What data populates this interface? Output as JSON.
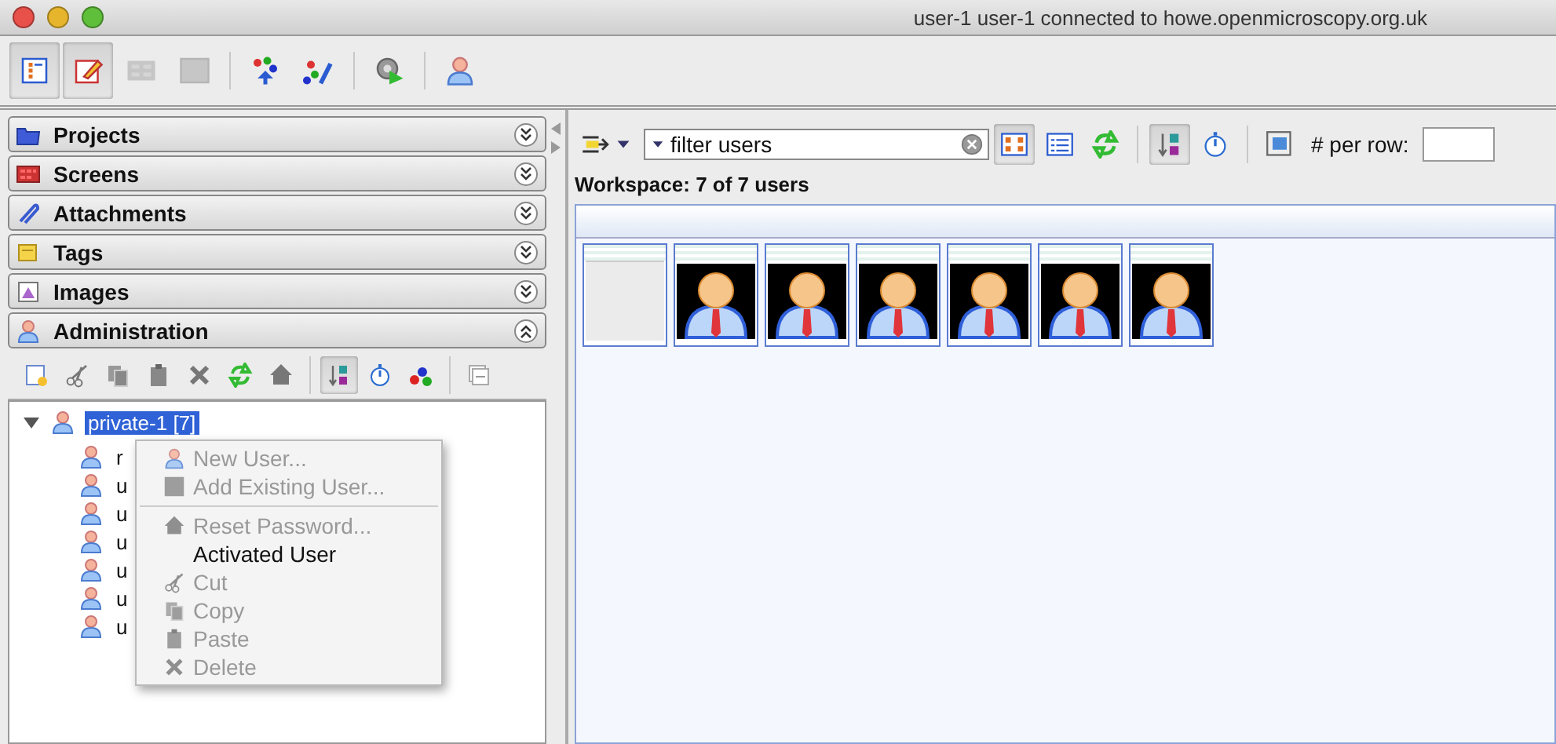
{
  "window": {
    "title": "user-1 user-1 connected to howe.openmicroscopy.org.uk"
  },
  "main_toolbar": [
    {
      "kind": "tree",
      "selected": true,
      "disabled": false
    },
    {
      "kind": "editor",
      "selected": true,
      "disabled": false
    },
    {
      "kind": "grid",
      "selected": false,
      "disabled": true
    },
    {
      "kind": "image",
      "selected": false,
      "disabled": true
    },
    {
      "kind": "sep"
    },
    {
      "kind": "people",
      "selected": false,
      "disabled": false
    },
    {
      "kind": "people-pen",
      "selected": false,
      "disabled": false
    },
    {
      "kind": "sep"
    },
    {
      "kind": "gear",
      "selected": false,
      "disabled": false
    },
    {
      "kind": "sep"
    },
    {
      "kind": "user",
      "selected": false,
      "disabled": false
    }
  ],
  "sections": [
    {
      "label": "Projects",
      "kind": "folder",
      "expanded": false
    },
    {
      "label": "Screens",
      "kind": "screen",
      "expanded": false
    },
    {
      "label": "Attachments",
      "kind": "clip",
      "expanded": false
    },
    {
      "label": "Tags",
      "kind": "tag",
      "expanded": false
    },
    {
      "label": "Images",
      "kind": "picture",
      "expanded": false
    },
    {
      "label": "Administration",
      "kind": "user",
      "expanded": true
    }
  ],
  "admin_toolbar": [
    {
      "kind": "new",
      "selected": false
    },
    {
      "kind": "cut",
      "selected": false
    },
    {
      "kind": "copy",
      "selected": false
    },
    {
      "kind": "paste",
      "selected": false
    },
    {
      "kind": "delete",
      "selected": false
    },
    {
      "kind": "refresh",
      "selected": false
    },
    {
      "kind": "home",
      "selected": false
    },
    {
      "kind": "sep"
    },
    {
      "kind": "sort",
      "selected": true
    },
    {
      "kind": "clock",
      "selected": false
    },
    {
      "kind": "spell",
      "selected": false
    },
    {
      "kind": "sep"
    },
    {
      "kind": "collapse",
      "selected": false
    }
  ],
  "tree": {
    "label": "private-1 [7]",
    "selected": true,
    "expanded": true,
    "children": [
      {
        "label": "r"
      },
      {
        "label": "u"
      },
      {
        "label": "u"
      },
      {
        "label": "u"
      },
      {
        "label": "u"
      },
      {
        "label": "u"
      },
      {
        "label": "u"
      }
    ]
  },
  "context_menu": [
    {
      "kind": "user",
      "label": "New User...",
      "disabled": true
    },
    {
      "kind": "add",
      "label": "Add Existing User...",
      "disabled": true
    },
    {
      "kind": "separator"
    },
    {
      "kind": "home",
      "label": "Reset Password...",
      "disabled": true
    },
    {
      "kind": "blank",
      "label": "Activated User",
      "disabled": false
    },
    {
      "kind": "cut",
      "label": "Cut",
      "disabled": true
    },
    {
      "kind": "copy",
      "label": "Copy",
      "disabled": true
    },
    {
      "kind": "paste",
      "label": "Paste",
      "disabled": true
    },
    {
      "kind": "delete",
      "label": "Delete",
      "disabled": true
    }
  ],
  "filter": {
    "value": "filter users"
  },
  "view_toolbar": [
    {
      "kind": "thumbs",
      "selected": true
    },
    {
      "kind": "list",
      "selected": false
    },
    {
      "kind": "refresh",
      "selected": false
    },
    {
      "kind": "sep"
    },
    {
      "kind": "sort",
      "selected": true
    },
    {
      "kind": "clock",
      "selected": false
    },
    {
      "kind": "sep"
    },
    {
      "kind": "imgview",
      "selected": false
    }
  ],
  "per_row": {
    "label": "# per row:"
  },
  "workspace_label": "Workspace: 7 of 7 users",
  "thumbnails": [
    {
      "kind": "blank"
    },
    {
      "kind": "user"
    },
    {
      "kind": "user"
    },
    {
      "kind": "user"
    },
    {
      "kind": "user"
    },
    {
      "kind": "user"
    },
    {
      "kind": "user"
    }
  ]
}
